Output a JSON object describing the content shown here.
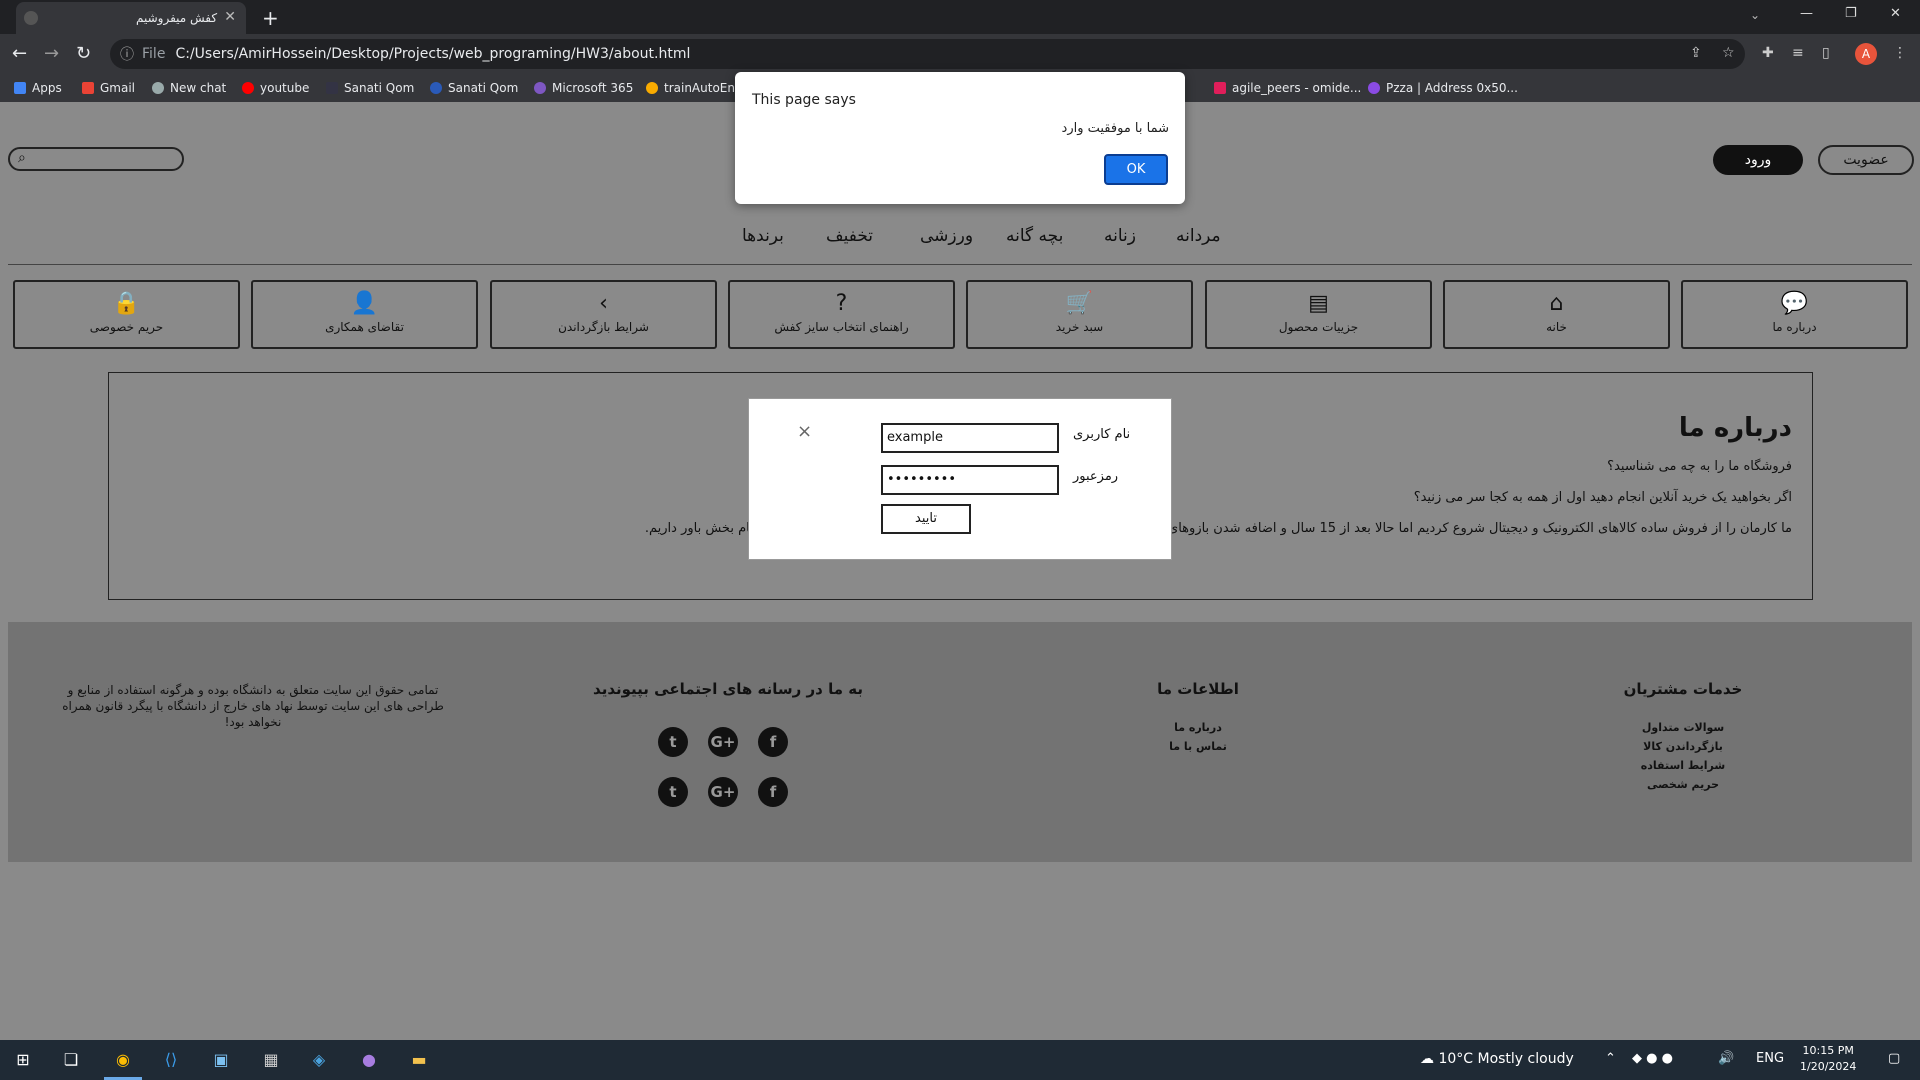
{
  "browser": {
    "tab_title": "کفش میفروشیم",
    "address": "C:/Users/AmirHossein/Desktop/Projects/web_programing/HW3/about.html",
    "address_scheme": "File",
    "profile_initial": "A",
    "bookmarks": [
      "Apps",
      "Gmail",
      "New chat",
      "youtube",
      "Sanati Qom",
      "Sanati Qom",
      "Microsoft 365",
      "trainAutoEnc...",
      "agile_peers - omide...",
      "Pzza | Address 0x50..."
    ]
  },
  "header": {
    "login_label": "ورود",
    "signup_label": "عضویت"
  },
  "categories": [
    "مردانه",
    "زنانه",
    "بچه گانه",
    "ورزشی",
    "تخفیف",
    "برندها"
  ],
  "iconbar": [
    {
      "label": "درباره ما",
      "icon": "chat-icon"
    },
    {
      "label": "خانه",
      "icon": "home-icon"
    },
    {
      "label": "جزییات محصول",
      "icon": "document-icon"
    },
    {
      "label": "سبد خرید",
      "icon": "cart-icon"
    },
    {
      "label": "راهنمای انتخاب سایز کفش",
      "icon": "question-icon"
    },
    {
      "label": "شرایط بازگرداندن",
      "icon": "chevron-left-icon"
    },
    {
      "label": "تقاضای همکاری",
      "icon": "user-icon"
    },
    {
      "label": "حریم خصوصی",
      "icon": "lock-icon"
    }
  ],
  "about": {
    "title": "درباره ما",
    "q1": "فروشگاه ما را به چه می شناسید؟",
    "q2": "اگر بخواهید یک خرید آنلاین انجام دهید اول از همه به کجا سر می زنید؟",
    "p1": "ما کارمان را از فروش ساده کالاهای الکترونیک و دیجیتال شروع کردیم اما حالا بعد از 15 سال و اضافه شدن بازوهای جدید ... رمیانه باشیم. برای تحقق این ماموریت به لبخند شما و ارزش‌هایی الهام بخش باور داریم."
  },
  "footer": {
    "customer_services": {
      "title": "خدمات مشتریان",
      "links": [
        "سوالات متداول",
        "بازگرداندن کالا",
        "شرایط استفاده",
        "حریم شخصی"
      ]
    },
    "our_info": {
      "title": "اطلاعات ما",
      "links": [
        "درباره ما",
        "تماس با ما"
      ]
    },
    "social": {
      "title": "به ما در رسانه های اجتماعی بپیوندید"
    },
    "copyright": "تمامی حقوق این سایت متعلق به دانشگاه بوده و هرگونه استفاده از منابع و طراحی های این سایت توسط نهاد های خارج از دانشگاه با پیگرد قانون همراه نخواهد بود!"
  },
  "login_modal": {
    "username_label": "نام کاربری",
    "username_value": "example",
    "password_label": "رمزعبور",
    "password_value": "•••••••••",
    "submit_label": "تایید",
    "close_glyph": "×"
  },
  "alert": {
    "title": "This page says",
    "message": "شما با موفقیت وارد",
    "ok_label": "OK"
  },
  "taskbar": {
    "weather": "10°C  Mostly cloudy",
    "lang": "ENG",
    "time": "10:15 PM",
    "date": "1/20/2024"
  }
}
